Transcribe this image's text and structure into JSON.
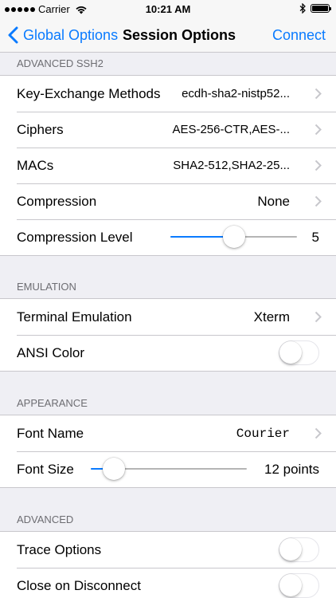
{
  "status_bar": {
    "carrier": "Carrier",
    "time": "10:21 AM",
    "signal_dots": 5,
    "icons": [
      "wifi-icon",
      "bluetooth-icon",
      "battery-icon"
    ]
  },
  "nav": {
    "back_label": "Global Options",
    "title": "Session Options",
    "action_label": "Connect",
    "accent_color": "#0a7bff"
  },
  "sections": {
    "ssh2": {
      "header": "ADVANCED SSH2",
      "key_exchange": {
        "label": "Key-Exchange Methods",
        "value": "ecdh-sha2-nistp52..."
      },
      "ciphers": {
        "label": "Ciphers",
        "value": "AES-256-CTR,AES-..."
      },
      "macs": {
        "label": "MACs",
        "value": "SHA2-512,SHA2-25..."
      },
      "compression": {
        "label": "Compression",
        "value": "None"
      },
      "compression_level": {
        "label": "Compression Level",
        "value": "5",
        "slider_fraction": 0.5
      }
    },
    "emulation": {
      "header": "EMULATION",
      "terminal": {
        "label": "Terminal Emulation",
        "value": "Xterm"
      },
      "ansi_color": {
        "label": "ANSI Color",
        "on": false
      }
    },
    "appearance": {
      "header": "APPEARANCE",
      "font_name": {
        "label": "Font Name",
        "value": "Courier"
      },
      "font_size": {
        "label": "Font Size",
        "value": "12 points",
        "slider_fraction": 0.15
      }
    },
    "advanced": {
      "header": "ADVANCED",
      "trace_options": {
        "label": "Trace Options",
        "on": false
      },
      "close_on_disconnect": {
        "label": "Close on Disconnect",
        "on": false
      }
    }
  }
}
